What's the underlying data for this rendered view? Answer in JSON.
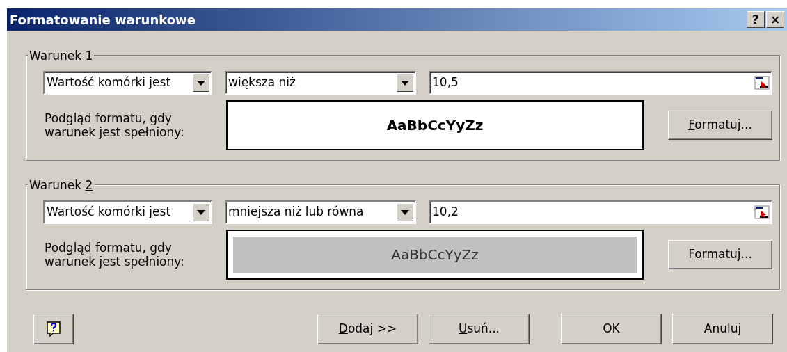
{
  "window": {
    "title": "Formatowanie warunkowe",
    "title_buttons": [
      "?",
      "×"
    ]
  },
  "conditions": [
    {
      "legend": [
        {
          "text": "Warunek ",
          "underlined": false
        },
        {
          "text": "1",
          "underlined": true
        }
      ],
      "type": "Wartość komórki jest",
      "operator": "większa niż",
      "value": "10,5",
      "preview_label": "Podgląd formatu, gdy warunek jest spełniony:",
      "preview_text": "AaBbCcYyZz",
      "preview_bold": true,
      "preview_shaded": false,
      "format_button": [
        {
          "text": "F",
          "underlined": true
        },
        {
          "text": "ormatuj...",
          "underlined": false
        }
      ]
    },
    {
      "legend": [
        {
          "text": "Warunek ",
          "underlined": false
        },
        {
          "text": "2",
          "underlined": true
        }
      ],
      "type": "Wartość komórki jest",
      "operator": "mniejsza niż lub równa",
      "value": "10,2",
      "preview_label": "Podgląd formatu, gdy warunek jest spełniony:",
      "preview_text": "AaBbCcYyZz",
      "preview_bold": false,
      "preview_shaded": true,
      "format_button": [
        {
          "text": "F",
          "underlined": false
        },
        {
          "text": "o",
          "underlined": true
        },
        {
          "text": "rmatuj...",
          "underlined": false
        }
      ]
    }
  ],
  "buttons": [
    {
      "label": [
        {
          "text": "D",
          "underlined": true
        },
        {
          "text": "odaj >>",
          "underlined": false
        }
      ]
    },
    {
      "label": [
        {
          "text": "U",
          "underlined": true
        },
        {
          "text": "suń...",
          "underlined": false
        }
      ]
    },
    {
      "label": [
        {
          "text": "OK",
          "underlined": false
        }
      ]
    },
    {
      "label": [
        {
          "text": "Anuluj",
          "underlined": false
        }
      ]
    }
  ]
}
